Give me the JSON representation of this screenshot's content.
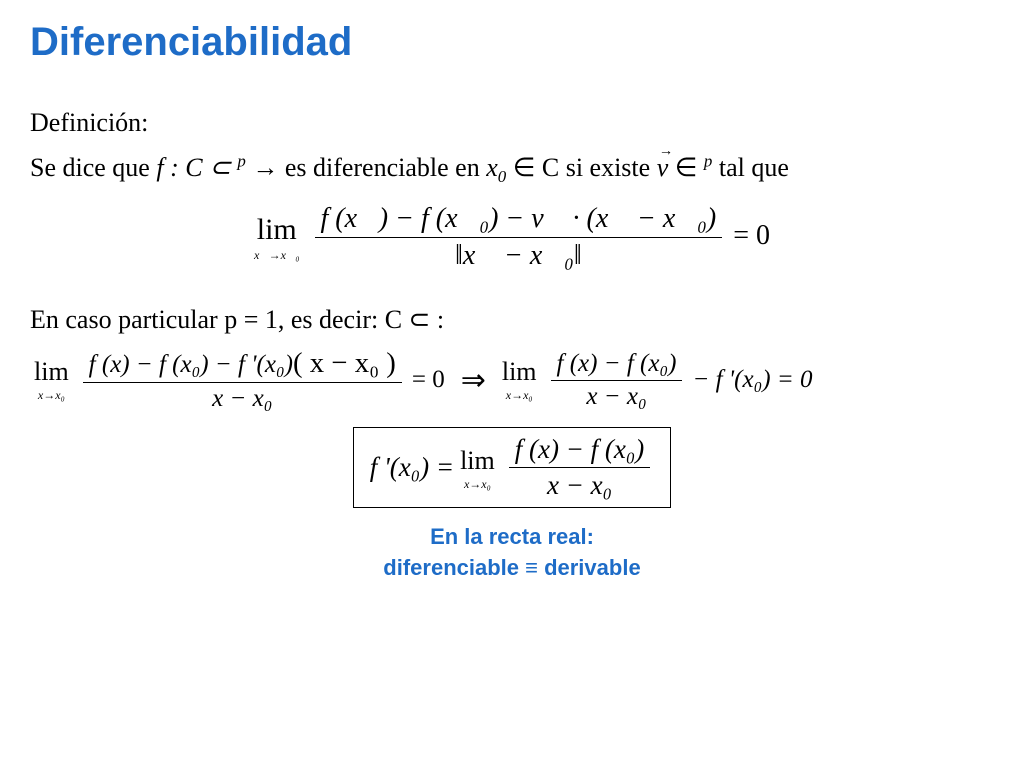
{
  "title": "Diferenciabilidad",
  "defLabel": "Definición:",
  "intro": {
    "part1": "Se dice que ",
    "func": "f : C ⊂ ",
    "glyph1": "",
    "sup_p": " p",
    "arrow": " → ",
    "glyph2": "",
    "part2": "  es diferenciable en ",
    "x0inC": "x",
    "sub0": "0",
    "inC": " ∈ C ",
    "part3": " si existe ",
    "vecv": "v",
    "inRp": " ∈ ",
    "glyph3": "",
    "sup_p2": " p",
    "part4": "  tal que"
  },
  "eq1": {
    "lim_sub": "x⃗→x⃗₀",
    "num": "f (x⃗) − f (x⃗₀) − v⃗ · (x⃗ − x⃗₀)",
    "den_l": "‖",
    "den_mid": "x⃗ − x⃗₀",
    "den_r": "‖",
    "eqzero": " = 0"
  },
  "case": {
    "text1": "En caso particular p = 1, es decir: C ⊂ ",
    "glyph": "",
    "colon": " :"
  },
  "eq2": {
    "lim_sub": "x→x₀",
    "numL": "f (x) − f (x₀) − f '(x₀)",
    "numL_paren": "( x − x₀ )",
    "denL": "x − x₀",
    "eqL": " = 0",
    "imply": "⇒",
    "numR": "f (x) − f (x₀)",
    "denR": "x − x₀",
    "tailR": " − f '(x₀) = 0"
  },
  "eq3": {
    "lhs": "f '(x₀) = ",
    "lim_sub": "x→x₀",
    "num": "f (x) − f (x₀)",
    "den": "x − x₀"
  },
  "footer": {
    "line1": "En la recta real:",
    "line2": "diferenciable ≡ derivable"
  }
}
